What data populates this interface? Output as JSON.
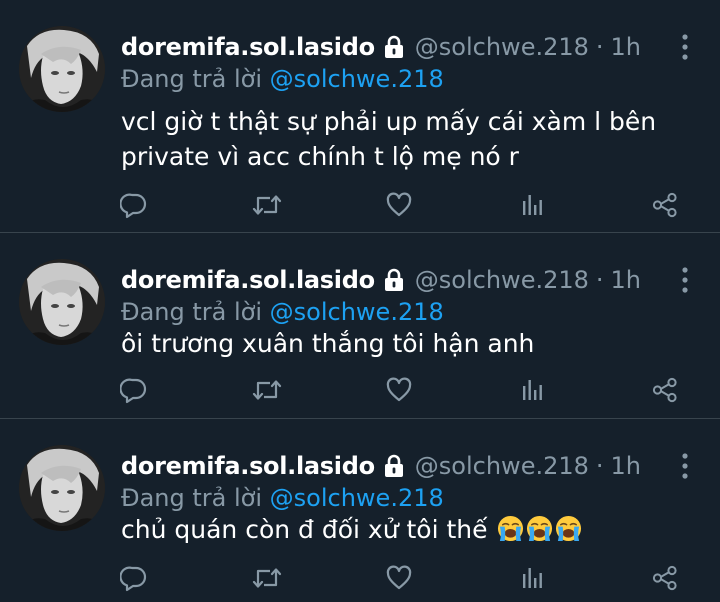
{
  "colors": {
    "background": "#15202b",
    "primary_text": "#ffffff",
    "secondary_text": "#8899a6",
    "accent": "#1da1f2",
    "divider": "#38444d"
  },
  "icons": {
    "lock": "lock-icon",
    "more": "more-vertical-icon",
    "reply": "reply-icon",
    "retweet": "retweet-icon",
    "like": "heart-icon",
    "stats": "analytics-icon",
    "share": "share-icon",
    "emoji": "loudly-crying-face-emoji"
  },
  "tweets": [
    {
      "display_name": "doremifa.sol.lasido",
      "handle": "@solchwe.218",
      "separator": "·",
      "time": "1h",
      "reply_prefix": "Đang trả lời",
      "reply_to": "@solchwe.218",
      "text": "vcl giờ t thật sự phải up mấy cái xàm l bên private vì acc chính t lộ mẹ nó r"
    },
    {
      "display_name": "doremifa.sol.lasido",
      "handle": "@solchwe.218",
      "separator": "·",
      "time": "1h",
      "reply_prefix": "Đang trả lời",
      "reply_to": "@solchwe.218",
      "text": "ôi trương xuân thắng tôi hận anh"
    },
    {
      "display_name": "doremifa.sol.lasido",
      "handle": "@solchwe.218",
      "separator": "·",
      "time": "1h",
      "reply_prefix": "Đang trả lời",
      "reply_to": "@solchwe.218",
      "text": "chủ quán còn đ đối xử tôi thế",
      "emoji_count": 3
    }
  ]
}
